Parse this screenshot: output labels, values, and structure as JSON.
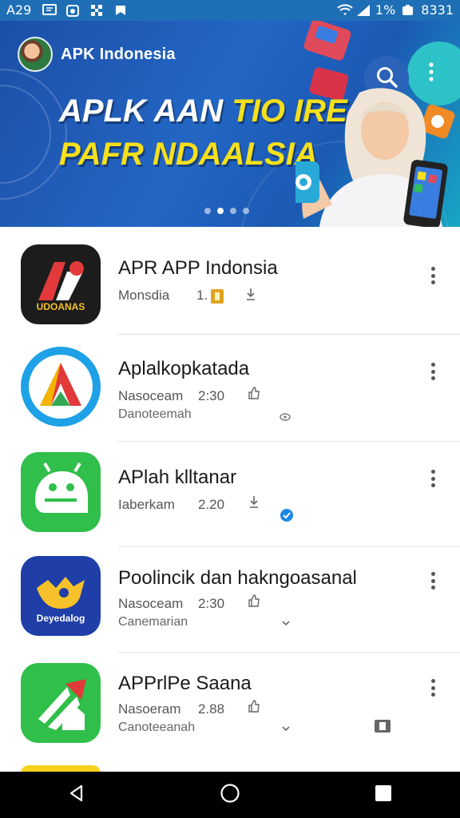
{
  "status_bar": {
    "time_left": "A29",
    "signal_text": "1%",
    "time_right": "8331",
    "icons": [
      "message-icon",
      "camera-icon",
      "grid-icon",
      "bag-icon",
      "wifi-icon",
      "signal-icon",
      "battery-icon"
    ]
  },
  "header": {
    "app_name": "APK Indonesia",
    "search_icon": "search-icon",
    "menu_icon": "more-vert-icon"
  },
  "banner": {
    "line1_white": "APLK AAN ",
    "line1_yellow": "TIO IRE:",
    "line2": "PAFR NDAALSIA",
    "carousel": {
      "count": 4,
      "active_index": 1
    }
  },
  "apps": [
    {
      "title": "APR APP Indonsia",
      "meta_name": "Monsdia",
      "meta_value": "1.",
      "meta2": "",
      "icon_label": "UDOANAS"
    },
    {
      "title": "Aplalkopkatada",
      "meta_name": "Nasoceam",
      "meta_value": "2:30",
      "meta2": "Danoteemah",
      "icon_label": ""
    },
    {
      "title": "APlah klltanar",
      "meta_name": "Iaberkam",
      "meta_value": "2.20",
      "meta2": "",
      "icon_label": ""
    },
    {
      "title": "Poolincik dan hakngoasanal",
      "meta_name": "Nasoceam",
      "meta_value": "2:30",
      "meta2": "Canemarian",
      "icon_label": "Deyedalog"
    },
    {
      "title": "APPrlPe Saana",
      "meta_name": "Nasoeram",
      "meta_value": "2.88",
      "meta2": "Canoteeanah",
      "icon_label": ""
    }
  ],
  "colors": {
    "status_bar": "#1f6fb6",
    "banner": "#2366c4",
    "accent_yellow": "#f6e01c",
    "nav_bar": "#000000"
  },
  "nav": {
    "back_icon": "back-triangle-icon",
    "home_icon": "home-circle-icon",
    "recents_icon": "recents-square-icon"
  }
}
